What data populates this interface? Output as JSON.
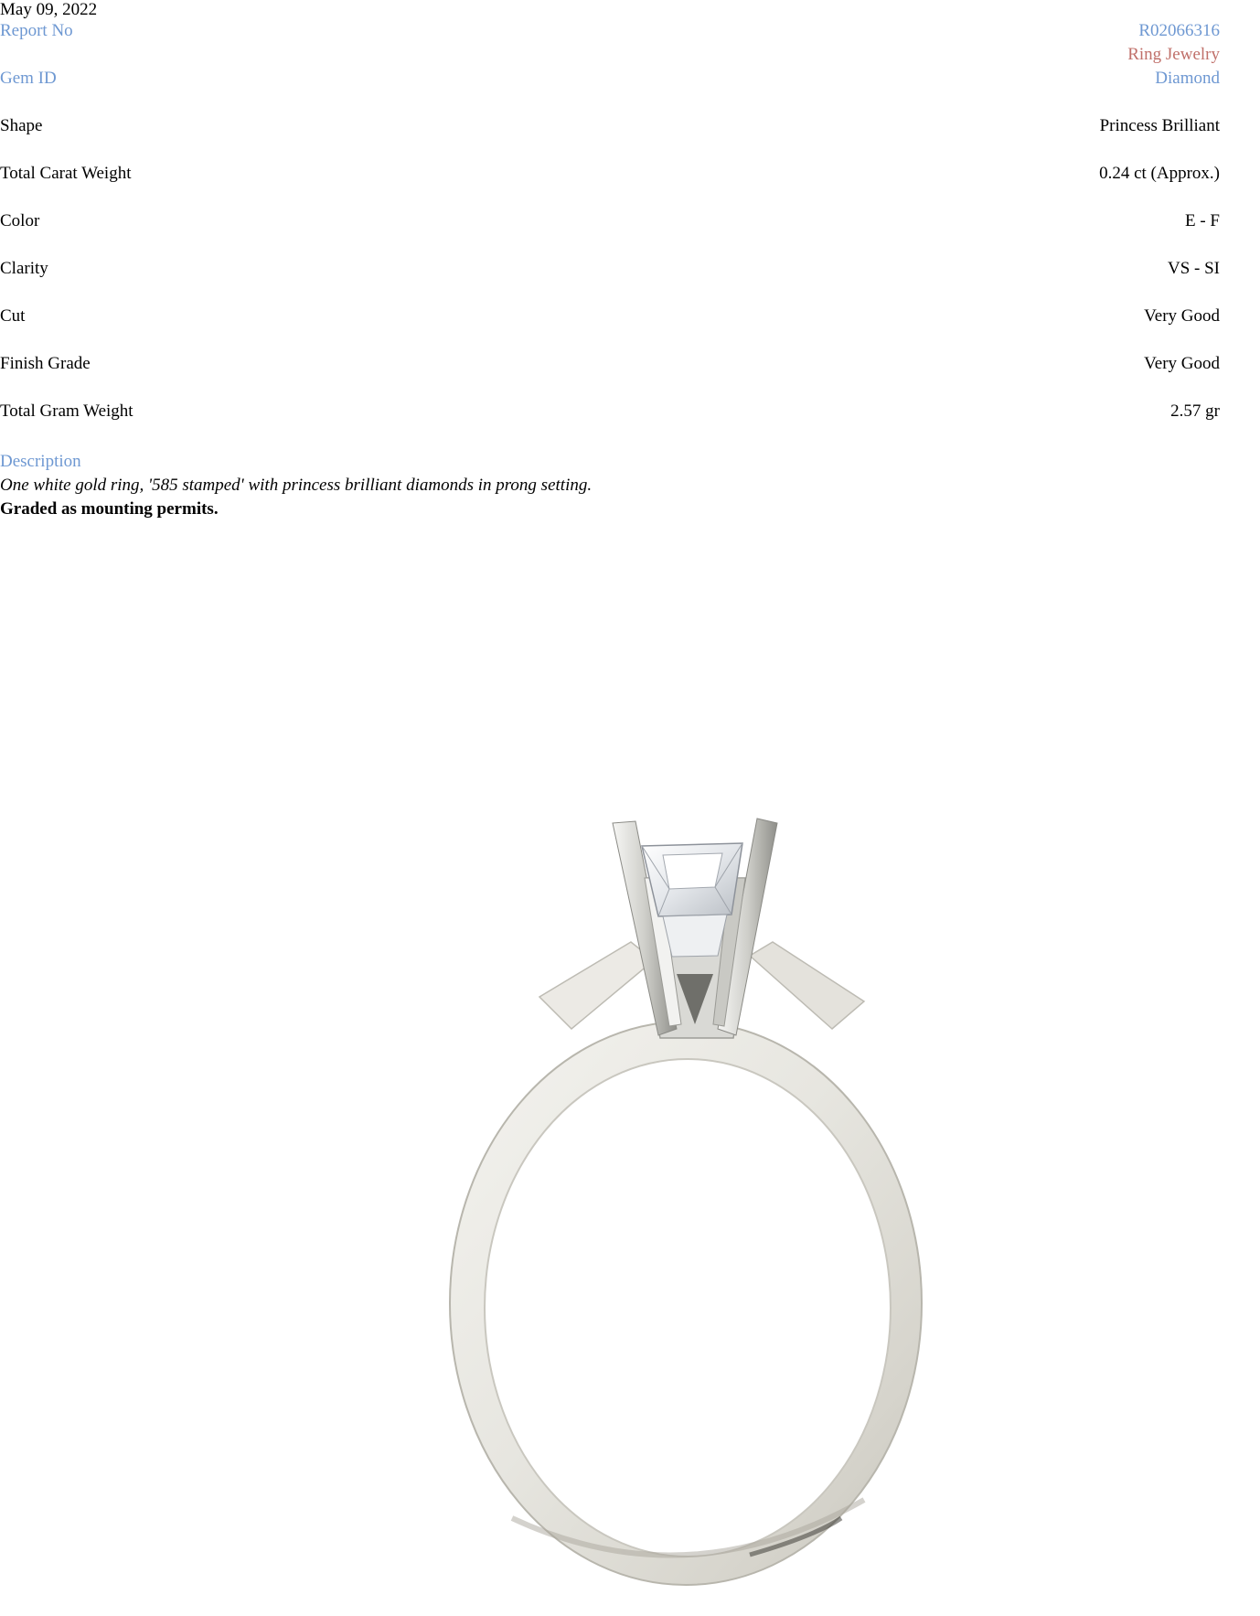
{
  "report": {
    "date": "May 09, 2022",
    "report_no_label": "Report No",
    "report_no_value": "R02066316",
    "category": "Ring Jewelry",
    "gem_id_label": "Gem ID",
    "gem_id_value": "Diamond",
    "fields": [
      {
        "label": "Shape",
        "value": "Princess Brilliant"
      },
      {
        "label": "Total Carat Weight",
        "value": "0.24 ct (Approx.)"
      },
      {
        "label": "Color",
        "value": "E - F"
      },
      {
        "label": "Clarity",
        "value": "VS - SI"
      },
      {
        "label": "Cut",
        "value": "Very Good"
      },
      {
        "label": "Finish Grade",
        "value": "Very Good"
      },
      {
        "label": "Total Gram Weight",
        "value": "2.57 gr"
      }
    ],
    "description_label": "Description",
    "description_text": "One white gold ring, '585 stamped' with princess brilliant diamonds in prong setting.",
    "description_note": "Graded as mounting permits."
  },
  "colors": {
    "label_blue": "#6e98d2",
    "category_red": "#c0706a",
    "text": "#000000",
    "background": "#ffffff"
  }
}
